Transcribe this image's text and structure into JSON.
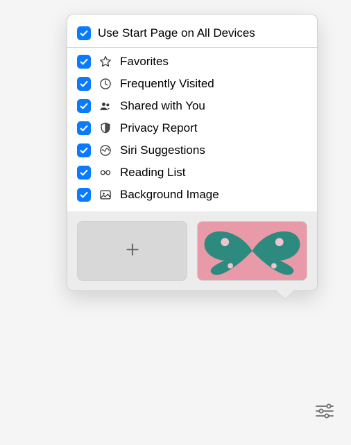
{
  "header": {
    "use_on_all_devices": {
      "label": "Use Start Page on All Devices",
      "checked": true
    }
  },
  "options": [
    {
      "id": "favorites",
      "label": "Favorites",
      "icon": "star-icon",
      "checked": true
    },
    {
      "id": "frequently-visited",
      "label": "Frequently Visited",
      "icon": "clock-icon",
      "checked": true
    },
    {
      "id": "shared-with-you",
      "label": "Shared with You",
      "icon": "people-icon",
      "checked": true
    },
    {
      "id": "privacy-report",
      "label": "Privacy Report",
      "icon": "shield-icon",
      "checked": true
    },
    {
      "id": "siri-suggestions",
      "label": "Siri Suggestions",
      "icon": "siri-icon",
      "checked": true
    },
    {
      "id": "reading-list",
      "label": "Reading List",
      "icon": "glasses-icon",
      "checked": true
    },
    {
      "id": "background-image",
      "label": "Background Image",
      "icon": "image-icon",
      "checked": true
    }
  ],
  "background_tiles": {
    "add_label": "Add Background",
    "thumbnail_desc": "Butterfly wallpaper (pink and teal)"
  },
  "colors": {
    "checkbox_blue": "#0a7aff",
    "popover_bg": "#ffffff",
    "section_bg": "#ececec"
  }
}
